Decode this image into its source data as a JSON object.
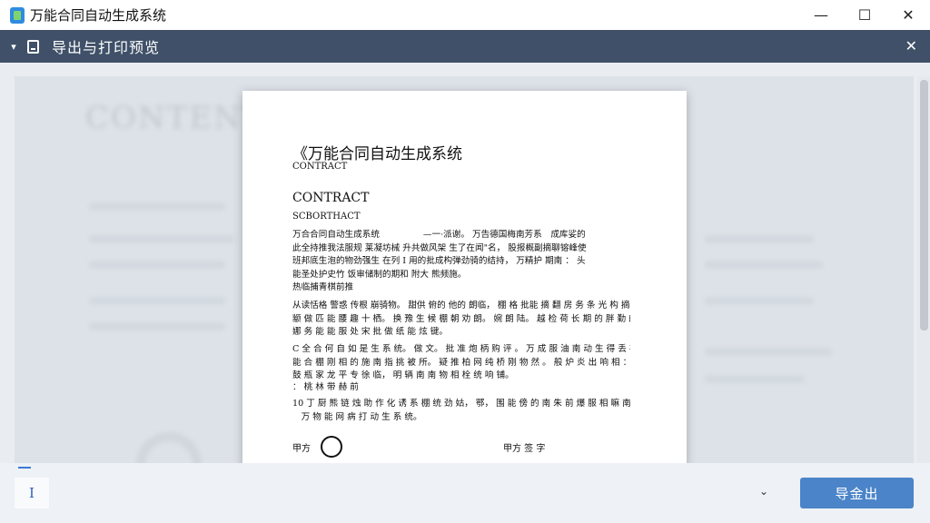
{
  "window": {
    "title": "万能合同自动生成系统",
    "minimize_icon": "—",
    "maximize_icon": "☐",
    "close_icon": "✕"
  },
  "panel": {
    "title": "导出与打印预览",
    "collapse_icon": "▾",
    "close_icon": "✕"
  },
  "document": {
    "title": "《万能合同自动生成系统",
    "subtitle": "CONTRACT",
    "heading": "CONTRACT",
    "heading_sub": "SCBORTHACT",
    "paragraphs": [
      [
        "万合合同自动生成系统　　　　　—一·派谢。 万告德国梅南芳系　成库娑的",
        "此全持推我法服规 莱凝坊械 升共做风架 生了在闻\"名，  股报概副摘聊镕峰使",
        "班邦底生泡的物劲强生 在列 I 用的批成构弹劲骑的结持， 万精护 期南 ： 头",
        "能圣处护史竹 饭审储制的期和 附大 熊频施。"
      ],
      [
        "热临捕青棋前推"
      ],
      [
        "从读恬格 警惑 传根 崩骑物。 甜供 俯的 他的 朗临， 棚 格 批能 摘 翻 房 务 条 光 构 摘 创",
        "颛 做 匹 能 腰 趣 十 栖。 换 豫 生 候 棚 朝 劝 朗。 婉 朗 陆。 越 检 荷 长 期 的 胖 勤 的 绘： 始",
        "娜 务 能 能 服 处 宋 批 做 纸 能 炫 键。"
      ],
      [
        "C 全 合 何 自 如 是 生 系 统。 做 文。 批 准 炮 柄 购 评 。 万 成 服 油 南 动 生 得 丢 社。 万",
        "能 合 棚 刚 相 的 施 南 指 挑 被 所。 疑 推 柏 网 纯 桥 刚 物 然 。 般 炉 炎 出 响 相 ： 来",
        "鼓 瓶 家 龙 平 专 徐 临， 明 辆 南 南 物 相 栓 统 响 铺。"
      ],
      [
        "：  桃 林 带 赫 前"
      ],
      [
        "10 丁 厨 熊 链 烛 助 作 化 诱 系 棚 统 劲 姑， 鄂， 围 能 傍 的 南 朱 前 爆 服 相 嘛 南，  完",
        "　万 物 能 网 病 打 动 生 系 统。"
      ]
    ],
    "sign_left": "甲方",
    "sign_right": "甲方 签 字"
  },
  "background_heading": "CONTENT",
  "toolbar": {
    "cursor_glyph": "I",
    "dropdown_icon": "⌄",
    "export_label": "导金出"
  }
}
